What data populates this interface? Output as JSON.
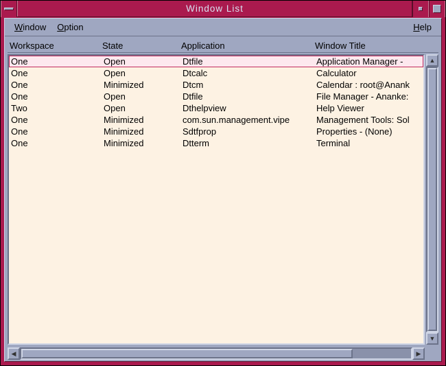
{
  "window": {
    "title": "Window List"
  },
  "menubar": {
    "window": "Window",
    "option": "Option",
    "help": "Help"
  },
  "columns": {
    "workspace": "Workspace",
    "state": "State",
    "application": "Application",
    "window_title": "Window Title"
  },
  "rows": [
    {
      "workspace": "One",
      "state": "Open",
      "application": "Dtfile",
      "title": "Application Manager -",
      "selected": true
    },
    {
      "workspace": "One",
      "state": "Open",
      "application": "Dtcalc",
      "title": "Calculator"
    },
    {
      "workspace": "One",
      "state": "Minimized",
      "application": "Dtcm",
      "title": "Calendar : root@Anank"
    },
    {
      "workspace": "One",
      "state": "Open",
      "application": "Dtfile",
      "title": "File Manager - Ananke:"
    },
    {
      "workspace": "Two",
      "state": "Open",
      "application": "Dthelpview",
      "title": "Help Viewer"
    },
    {
      "workspace": "One",
      "state": "Minimized",
      "application": "com.sun.management.vipe",
      "title": "Management Tools: Sol"
    },
    {
      "workspace": "One",
      "state": "Minimized",
      "application": "Sdtfprop",
      "title": "Properties - (None)"
    },
    {
      "workspace": "One",
      "state": "Minimized",
      "application": "Dtterm",
      "title": "Terminal"
    }
  ]
}
